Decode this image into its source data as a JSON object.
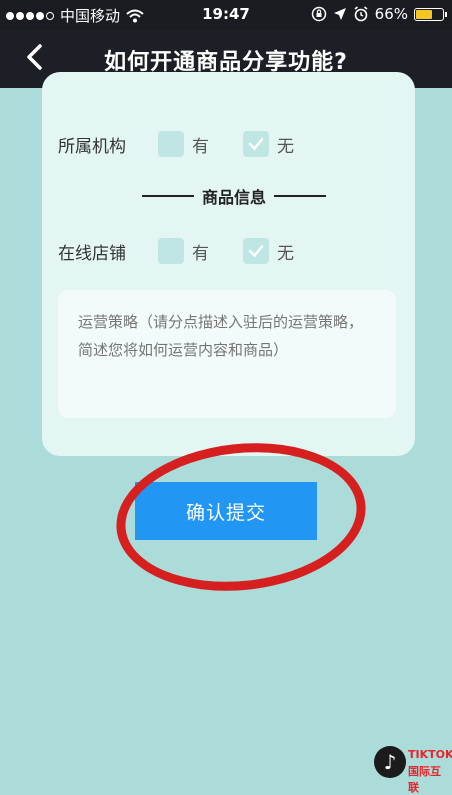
{
  "status_bar": {
    "carrier": "中国移动",
    "time": "19:47",
    "battery": "66%",
    "battery_level": 0.66,
    "icons": [
      "signal-dots-icon",
      "wifi-icon",
      "orientation-lock-icon",
      "location-arrow-icon",
      "alarm-icon",
      "battery-icon"
    ]
  },
  "nav": {
    "back_icon": "chevron-left-icon",
    "title": "如何开通商品分享功能?"
  },
  "form": {
    "org_row": {
      "label": "所属机构",
      "opt_yes": "有",
      "opt_no": "无",
      "selected": "无"
    },
    "section_title": "商品信息",
    "store_row": {
      "label": "在线店铺",
      "opt_yes": "有",
      "opt_no": "无",
      "selected": "无"
    },
    "strategy_placeholder": "运营策略（请分点描述入驻后的运营策略，简述您将如何运营内容和商品）",
    "submit_label": "确认提交"
  },
  "watermark": {
    "logo_line1": "TIKTOK",
    "logo_line2": "国际互联"
  },
  "colors": {
    "background": "#abdcd9",
    "nav_bar": "#1d1f26",
    "card": "#e3f6f4",
    "submit_button": "#2196f3",
    "annotation_circle": "#d61f1f"
  }
}
